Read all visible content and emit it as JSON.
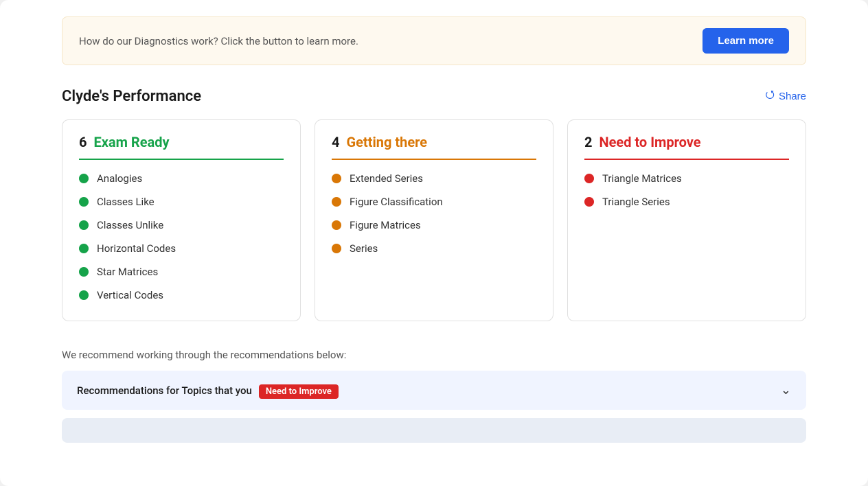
{
  "info_banner": {
    "text": "How do our Diagnostics work? Click the button to learn more.",
    "button_label": "Learn more"
  },
  "performance_section": {
    "title": "Clyde's Performance",
    "share_label": "Share"
  },
  "cards": [
    {
      "id": "exam-ready",
      "count": "6",
      "label": "Exam Ready",
      "color": "green",
      "items": [
        "Analogies",
        "Classes Like",
        "Classes Unlike",
        "Horizontal Codes",
        "Star Matrices",
        "Vertical Codes"
      ]
    },
    {
      "id": "getting-there",
      "count": "4",
      "label": "Getting there",
      "color": "orange",
      "items": [
        "Extended Series",
        "Figure Classification",
        "Figure Matrices",
        "Series"
      ]
    },
    {
      "id": "need-to-improve",
      "count": "2",
      "label": "Need to Improve",
      "color": "red",
      "items": [
        "Triangle Matrices",
        "Triangle Series"
      ]
    }
  ],
  "recommendation": {
    "text": "We recommend working through the recommendations below:",
    "label_prefix": "Recommendations for Topics that you",
    "badge_label": "Need to Improve"
  }
}
